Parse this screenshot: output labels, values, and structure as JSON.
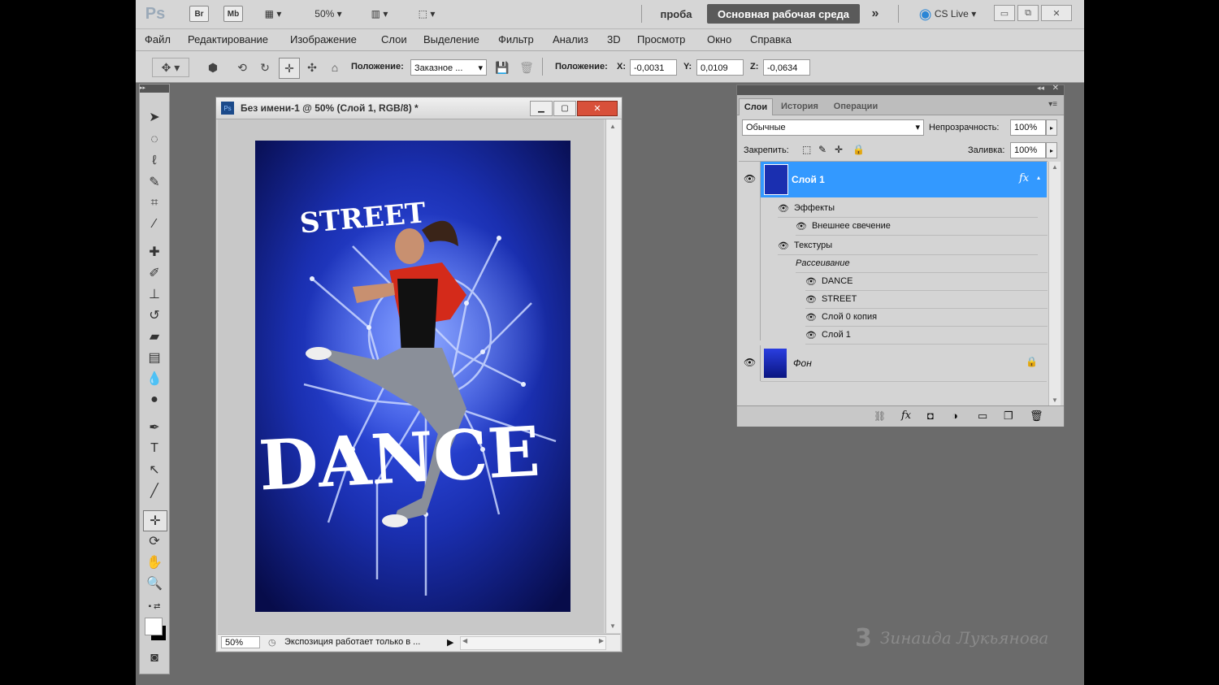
{
  "appbar": {
    "ps_logo": "Ps",
    "br_label": "Br",
    "mb_label": "Mb",
    "zoom": "50%",
    "workspace_name": "проба",
    "workspace_button": "Основная рабочая среда",
    "cs_live": "CS Live"
  },
  "menu": [
    "Файл",
    "Редактирование",
    "Изображение",
    "Слои",
    "Выделение",
    "Фильтр",
    "Анализ",
    "3D",
    "Просмотр",
    "Окно",
    "Справка"
  ],
  "options": {
    "position_label": "Положение:",
    "position_value": "Заказное ...",
    "position2_label": "Положение:",
    "x_label": "X:",
    "x_value": "-0,0031",
    "y_label": "Y:",
    "y_value": "0,0109",
    "z_label": "Z:",
    "z_value": "-0,0634"
  },
  "document": {
    "title": "Без имени-1 @ 50% (Слой 1, RGB/8) *",
    "poster_title_top": "STREET",
    "poster_title_main": "DANCE",
    "status_zoom": "50%",
    "status_text": "Экспозиция работает только в ..."
  },
  "layers_panel": {
    "tabs": [
      "Слои",
      "История",
      "Операции"
    ],
    "blend_mode": "Обычные",
    "opacity_label": "Непрозрачность:",
    "opacity_value": "100%",
    "lock_label": "Закрепить:",
    "fill_label": "Заливка:",
    "fill_value": "100%",
    "layer1": {
      "name": "Слой 1",
      "fx": "fx"
    },
    "effects_label": "Эффекты",
    "outer_glow": "Внешнее свечение",
    "textures_label": "Текстуры",
    "scatter_label": "Рассеивание",
    "sublayers": [
      "DANCE",
      "STREET",
      "Слой 0 копия",
      "Слой 1"
    ],
    "background": {
      "name": "Фон"
    }
  },
  "watermark": "Зинаида Лукьянова",
  "colors": {
    "accent": "#3399ff",
    "poster_bg": "#1a2fb0",
    "workspace_btn": "#5a5a5a"
  }
}
